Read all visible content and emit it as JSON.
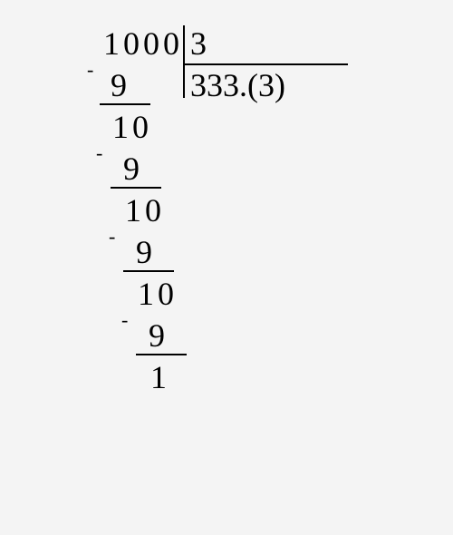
{
  "division": {
    "dividend": "1000",
    "divisor": "3",
    "quotient": "333.(3)",
    "steps": [
      {
        "subtrahend": "9",
        "result": "10"
      },
      {
        "subtrahend": "9",
        "result": "10"
      },
      {
        "subtrahend": "9",
        "result": "10"
      },
      {
        "subtrahend": "9",
        "result": "1"
      }
    ],
    "minus": "-"
  }
}
